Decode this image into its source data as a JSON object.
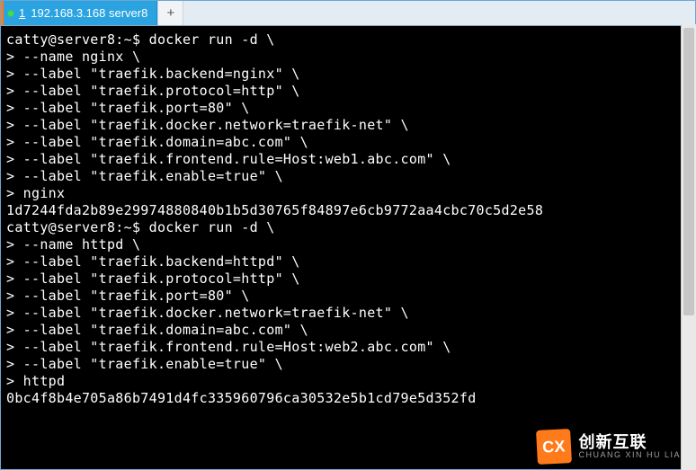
{
  "tab": {
    "index": "1",
    "title": "192.168.3.168 server8"
  },
  "newtab_label": "+",
  "terminal": {
    "lines": [
      "catty@server8:~$ docker run -d \\",
      "> --name nginx \\",
      "> --label \"traefik.backend=nginx\" \\",
      "> --label \"traefik.protocol=http\" \\",
      "> --label \"traefik.port=80\" \\",
      "> --label \"traefik.docker.network=traefik-net\" \\",
      "> --label \"traefik.domain=abc.com\" \\",
      "> --label \"traefik.frontend.rule=Host:web1.abc.com\" \\",
      "> --label \"traefik.enable=true\" \\",
      "> nginx",
      "1d7244fda2b89e29974880840b1b5d30765f84897e6cb9772aa4cbc70c5d2e58",
      "catty@server8:~$ docker run -d \\",
      "> --name httpd \\",
      "> --label \"traefik.backend=httpd\" \\",
      "> --label \"traefik.protocol=http\" \\",
      "> --label \"traefik.port=80\" \\",
      "> --label \"traefik.docker.network=traefik-net\" \\",
      "> --label \"traefik.domain=abc.com\" \\",
      "> --label \"traefik.frontend.rule=Host:web2.abc.com\" \\",
      "> --label \"traefik.enable=true\" \\",
      "> httpd",
      "0bc4f8b4e705a86b7491d4fc335960796ca30532e5b1cd79e5d352fd"
    ]
  },
  "watermark": {
    "logo_text": "CX",
    "cn": "创新互联",
    "en": "CHUANG XIN HU LIAN"
  }
}
